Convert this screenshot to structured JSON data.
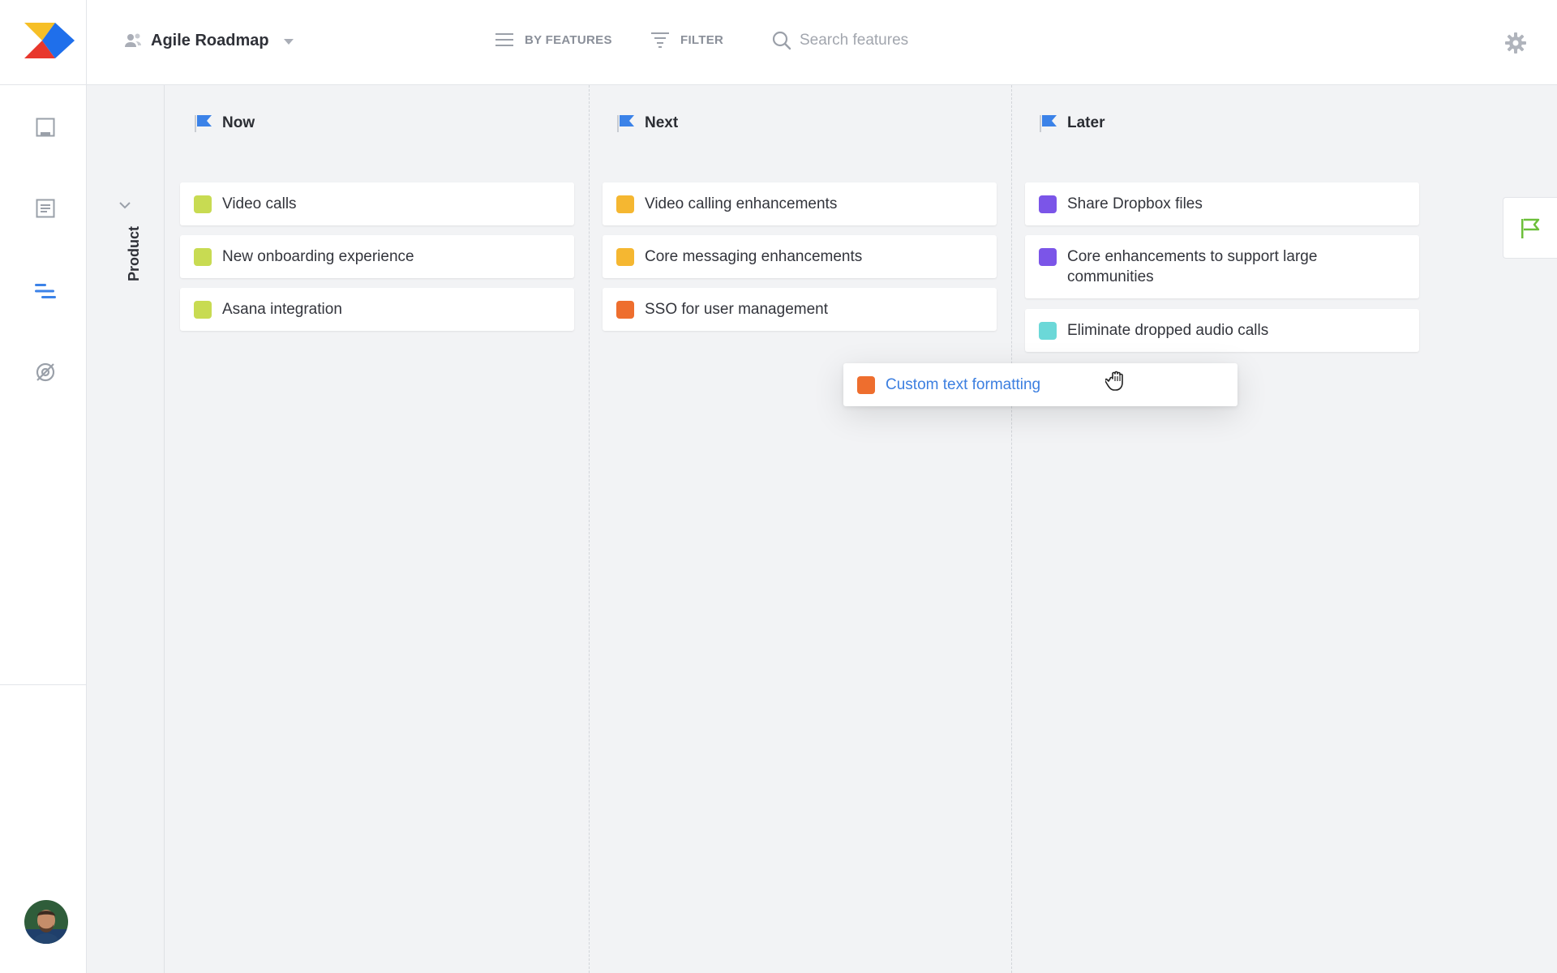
{
  "header": {
    "roadmap_name": "Agile Roadmap",
    "view_label": "BY FEATURES",
    "filter_label": "FILTER",
    "search_placeholder": "Search features"
  },
  "sidebar": {
    "items": [
      {
        "icon": "inbox-icon"
      },
      {
        "icon": "document-icon"
      },
      {
        "icon": "roadmap-icon",
        "active": true
      },
      {
        "icon": "hidden-eye-icon"
      }
    ]
  },
  "group": {
    "label": "Product"
  },
  "columns": [
    {
      "title": "Now",
      "cards": [
        {
          "label": "Video calls",
          "color": "#c8db52"
        },
        {
          "label": "New onboarding experience",
          "color": "#c8db52"
        },
        {
          "label": "Asana integration",
          "color": "#c8db52"
        }
      ]
    },
    {
      "title": "Next",
      "cards": [
        {
          "label": "Video calling enhancements",
          "color": "#f5b731"
        },
        {
          "label": "Core messaging enhancements",
          "color": "#f5b731"
        },
        {
          "label": "SSO for user management",
          "color": "#ee6e2e"
        }
      ]
    },
    {
      "title": "Later",
      "cards": [
        {
          "label": "Share Dropbox files",
          "color": "#7b55e8"
        },
        {
          "label": "Core enhancements to support large communities",
          "color": "#7b55e8"
        },
        {
          "label": "Eliminate dropped audio calls",
          "color": "#6bd8d8"
        }
      ]
    }
  ],
  "dragging_card": {
    "label": "Custom text formatting",
    "color": "#ee6e2e"
  },
  "colors": {
    "accent_blue": "#3b82e8",
    "flag_green": "#6cbf3a"
  }
}
